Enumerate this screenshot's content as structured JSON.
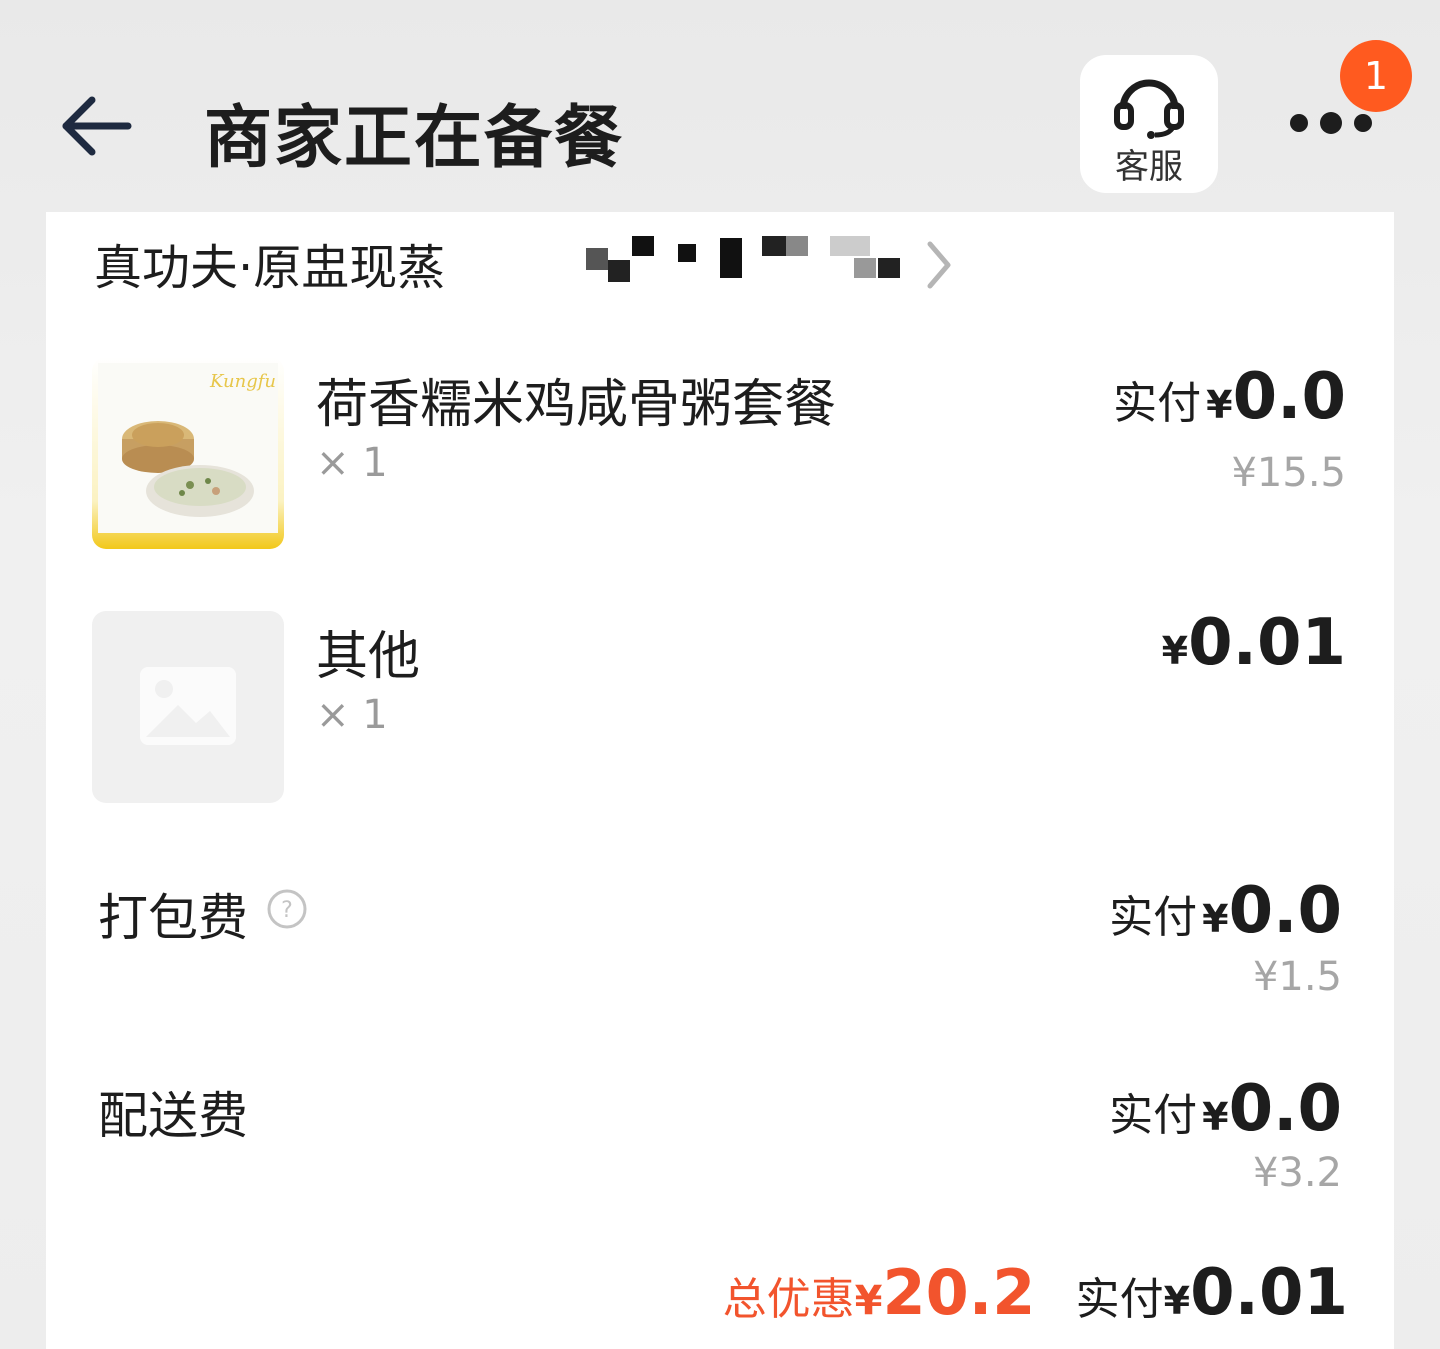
{
  "header": {
    "title": "商家正在备餐",
    "customer_service_label": "客服",
    "notification_count": "1"
  },
  "shop": {
    "name": "真功夫·原盅现蒸"
  },
  "items": [
    {
      "name": "荷香糯米鸡咸骨粥套餐",
      "qty": "× 1",
      "paid_label": "实付",
      "currency": "¥",
      "paid": "0.0",
      "original": "¥15.5"
    },
    {
      "name": "其他",
      "qty": "× 1",
      "currency": "¥",
      "price": "0.01"
    }
  ],
  "fees": [
    {
      "label": "打包费",
      "paid_label": "实付",
      "currency": "¥",
      "paid": "0.0",
      "original": "¥1.5"
    },
    {
      "label": "配送费",
      "paid_label": "实付",
      "currency": "¥",
      "paid": "0.0",
      "original": "¥3.2"
    }
  ],
  "total": {
    "discount_label": "总优惠",
    "currency": "¥",
    "discount": "20.2",
    "paid_label": "实付",
    "paid": "0.01"
  },
  "colors": {
    "accent": "#f2542d",
    "badge": "#ff5a1f"
  }
}
